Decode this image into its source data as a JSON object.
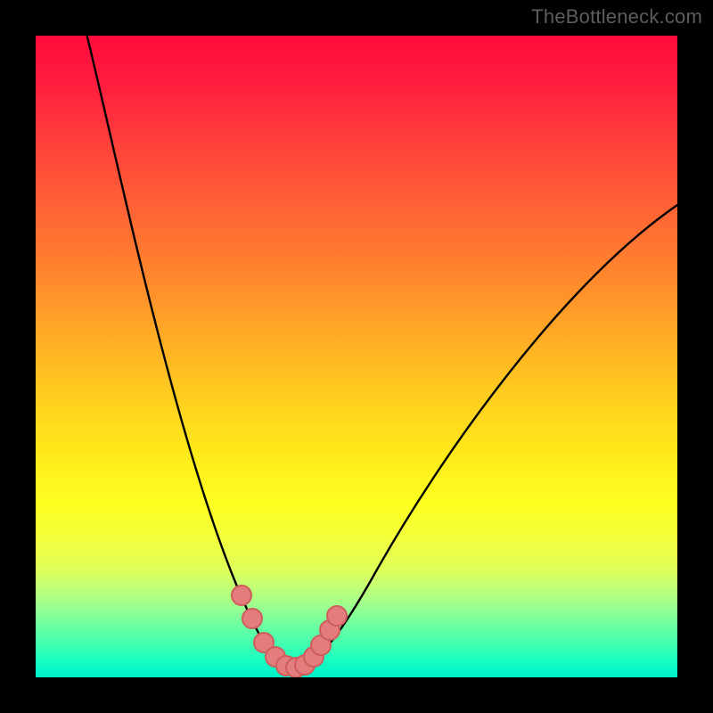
{
  "watermark": {
    "text": "TheBottleneck.com"
  },
  "colors": {
    "frame": "#000000",
    "curve": "#000000",
    "marker_fill": "#e37c7c",
    "marker_stroke": "#cf5c5c"
  },
  "chart_data": {
    "type": "line",
    "title": "",
    "xlabel": "",
    "ylabel": "",
    "xlim": [
      0,
      100
    ],
    "ylim": [
      0,
      100
    ],
    "grid": false,
    "note": "No numeric axis ticks or labels are visible; values below are pixel-normalized estimates (0–100) of the plotted V-shaped curve and markers. Origin (0,0) is bottom-left of the gradient plot area.",
    "series": [
      {
        "name": "curve",
        "x": [
          8,
          10,
          12,
          14,
          16,
          18,
          20,
          22,
          24,
          26,
          28,
          30,
          32,
          33.5,
          35,
          36.5,
          38,
          39,
          40,
          41.5,
          43,
          45,
          48,
          52,
          56,
          60,
          64,
          68,
          72,
          76,
          80,
          84,
          88,
          92,
          96,
          100
        ],
        "values": [
          100,
          92,
          84,
          76,
          68,
          60,
          52,
          44,
          37,
          30,
          24,
          18,
          13,
          9,
          6,
          4,
          2.5,
          1.8,
          1.5,
          1.6,
          2.2,
          4,
          8,
          14,
          21,
          28,
          35,
          41,
          47,
          53,
          58,
          62,
          66,
          69,
          72,
          74
        ]
      },
      {
        "name": "markers",
        "x": [
          32,
          33.8,
          35.5,
          37.3,
          39,
          40.5,
          42,
          43.3,
          44.5,
          45.8,
          47
        ],
        "values": [
          12.5,
          9,
          5.5,
          3.2,
          1.8,
          1.5,
          2,
          3.2,
          5,
          7.2,
          9.5
        ]
      }
    ]
  }
}
